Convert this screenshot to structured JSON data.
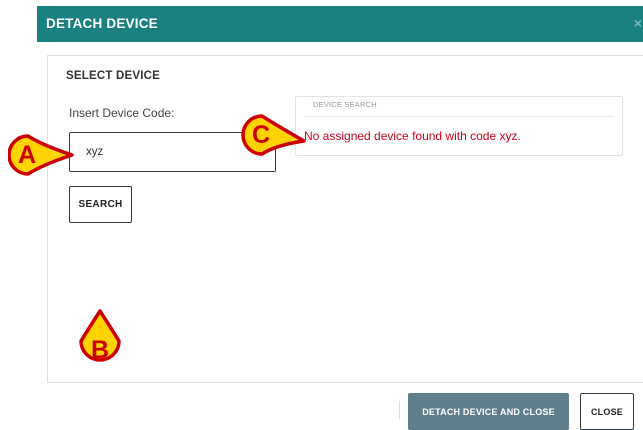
{
  "dialog": {
    "title": "DETACH DEVICE",
    "close_glyph": "×"
  },
  "select_device": {
    "section_title": "SELECT DEVICE",
    "field_label": "Insert Device Code:",
    "code_value": "xyz",
    "search_label": "SEARCH"
  },
  "device_search": {
    "header": "DEVICE SEARCH",
    "message": "No assigned device found with code xyz."
  },
  "markers": {
    "a": "A",
    "b": "B",
    "c": "C"
  },
  "footer": {
    "detach_label": "DETACH DEVICE AND CLOSE",
    "close_label": "CLOSE"
  },
  "colors": {
    "title_bar": "#1a8080",
    "error_text": "#d0021b",
    "marker_fill": "#ffd200",
    "marker_border": "#cc0000",
    "detach_button": "#607d8b"
  }
}
